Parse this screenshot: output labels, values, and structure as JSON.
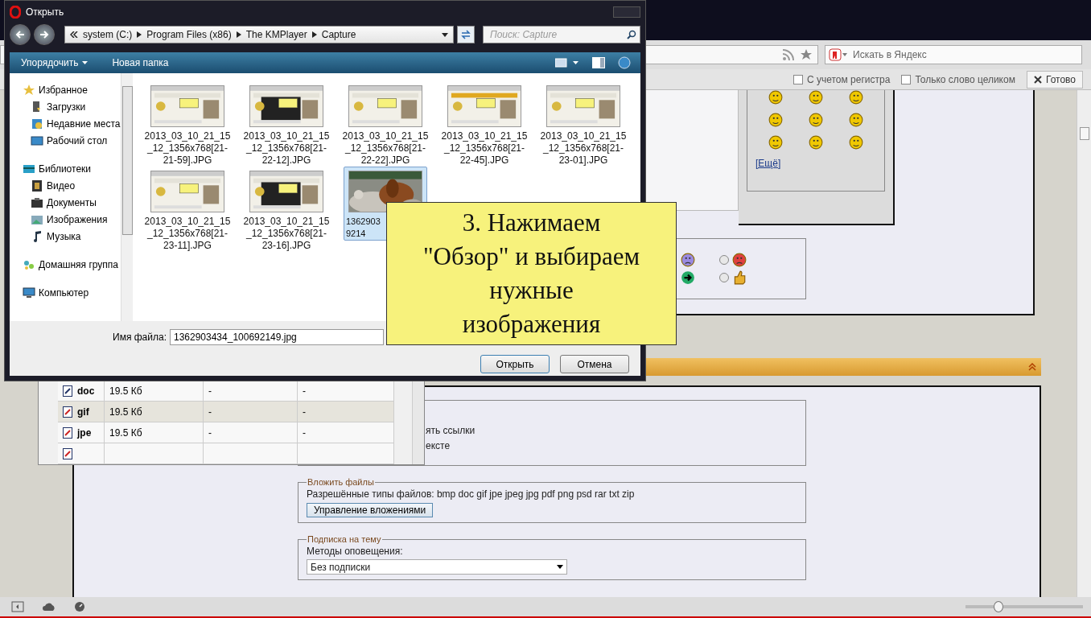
{
  "dialog": {
    "title": "Открыть",
    "breadcrumb": [
      "system (C:)",
      "Program Files (x86)",
      "The KMPlayer",
      "Capture"
    ],
    "search": {
      "placeholder": "Поиск: Capture"
    },
    "toolbar": [
      "Упорядочить",
      "Новая папка"
    ],
    "sidebar": [
      {
        "label": "Избранное",
        "kind": "star",
        "children": [
          {
            "label": "Загрузки",
            "kind": "downloads"
          },
          {
            "label": "Недавние места",
            "kind": "recent"
          },
          {
            "label": "Рабочий стол",
            "kind": "desktop"
          }
        ]
      },
      {
        "label": "Библиотеки",
        "kind": "library",
        "children": [
          {
            "label": "Видео",
            "kind": "video"
          },
          {
            "label": "Документы",
            "kind": "documents"
          },
          {
            "label": "Изображения",
            "kind": "pictures"
          },
          {
            "label": "Музыка",
            "kind": "music"
          }
        ]
      },
      {
        "label": "Домашняя группа",
        "kind": "homegroup"
      },
      {
        "label": "Компьютер",
        "kind": "computer"
      }
    ],
    "files": [
      {
        "name": [
          "2013_03_10_21_15",
          "_12_1356x768[21-",
          "21-59].JPG"
        ],
        "kind": "screenshot",
        "selected": false
      },
      {
        "name": [
          "2013_03_10_21_15",
          "_12_1356x768[21-",
          "22-12].JPG"
        ],
        "kind": "screenshot",
        "selected": false
      },
      {
        "name": [
          "2013_03_10_21_15",
          "_12_1356x768[21-",
          "22-22].JPG"
        ],
        "kind": "screenshot",
        "selected": false
      },
      {
        "name": [
          "2013_03_10_21_15",
          "_12_1356x768[21-",
          "22-45].JPG"
        ],
        "kind": "screenshot",
        "selected": false
      },
      {
        "name": [
          "2013_03_10_21_15",
          "_12_1356x768[21-",
          "23-01].JPG"
        ],
        "kind": "screenshot",
        "selected": false
      },
      {
        "name": [
          "2013_03_10_21_15",
          "_12_1356x768[21-",
          "23-11].JPG"
        ],
        "kind": "screenshot",
        "selected": false
      },
      {
        "name": [
          "2013_03_10_21_15",
          "_12_1356x768[21-",
          "23-16].JPG"
        ],
        "kind": "screenshot",
        "selected": false
      },
      {
        "name": [
          "1362903",
          "9214"
        ],
        "selected": true
      }
    ],
    "file_name": {
      "label": "Имя файла:",
      "value": "1362903434_100692149.jpg"
    },
    "buttons": [
      "Открыть",
      "Отмена"
    ]
  },
  "note": [
    "3. Нажимаем",
    "\"Обзор\" и выбираем",
    "нужные",
    "изображения"
  ],
  "browser": {
    "search": {
      "placeholder": "Искать в Яндекс"
    },
    "find_bar": {
      "options": [
        {
          "label": "С учетом регистра",
          "checked": false
        },
        {
          "label": "Только слово целиком",
          "checked": false
        }
      ],
      "done": "Готово"
    },
    "more_link": "[Ещё]",
    "radios": [
      {
        "kind": "angry",
        "selected": false
      },
      {
        "kind": "thumbs",
        "selected": false
      }
    ],
    "options_fragment": [
      "ять ссылки",
      "ексте"
    ],
    "attach": {
      "legend": "Вложить файлы",
      "types": "Разрешённые типы файлов: bmp doc gif jpe jpeg jpg pdf png psd rar txt zip",
      "button": "Управление вложениями"
    },
    "subscribe": {
      "legend": "Подписка на тему",
      "label": "Методы оповещения:",
      "value": "Без подписки"
    },
    "zoom": {
      "level": 0.28
    }
  },
  "attachments": [
    {
      "ext": "doc",
      "size": "19.5 Кб",
      "column_3": "-",
      "column_4": "-"
    },
    {
      "ext": "gif",
      "size": "19.5 Кб",
      "column_3": "-",
      "column_4": "-"
    },
    {
      "ext": "jpe",
      "size": "19.5 Кб",
      "column_3": "-",
      "column_4": "-"
    }
  ]
}
